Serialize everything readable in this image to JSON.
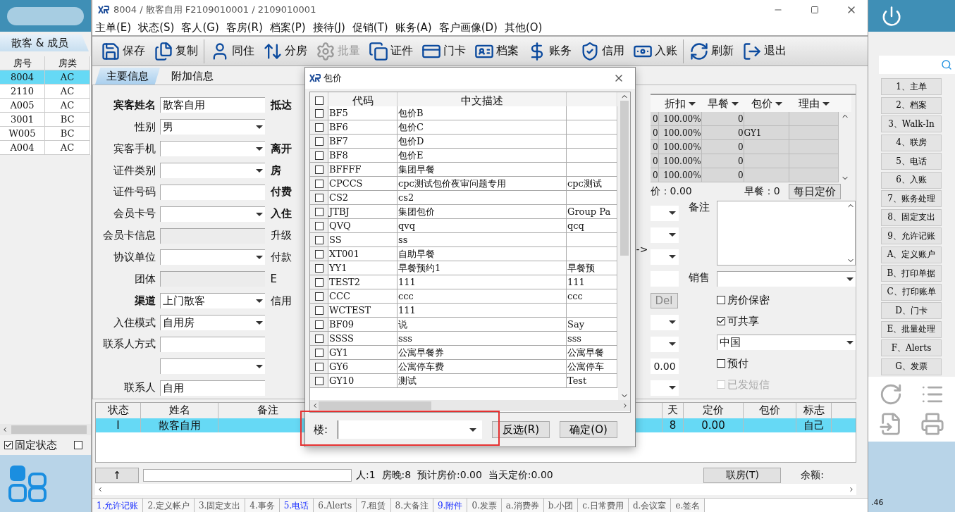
{
  "left_panel": {
    "tab": "散客 & 成员",
    "columns": [
      "房号",
      "房类"
    ],
    "rows": [
      {
        "room": "8004",
        "type": "AC",
        "selected": true
      },
      {
        "room": "2110",
        "type": "AC",
        "selected": false
      },
      {
        "room": "A005",
        "type": "AC",
        "selected": false
      },
      {
        "room": "3001",
        "type": "BC",
        "selected": false
      },
      {
        "room": "W005",
        "type": "BC",
        "selected": false
      },
      {
        "room": "A004",
        "type": "AC",
        "selected": false
      }
    ],
    "fixed_state": {
      "label": "固定状态",
      "checked": true
    },
    "second_checkbox": {
      "checked": false
    }
  },
  "window": {
    "title": "8004 / 散客自用  F2109010001 / 2109010001"
  },
  "menu": [
    "主单(E)",
    "状态(S)",
    "客人(G)",
    "客房(R)",
    "档案(P)",
    "接待(J)",
    "促销(T)",
    "账务(A)",
    "客户画像(D)",
    "其他(O)"
  ],
  "toolbar": [
    {
      "label": "保存",
      "disabled": false
    },
    {
      "label": "复制",
      "disabled": false
    },
    {
      "label": "同住",
      "disabled": false
    },
    {
      "label": "分房",
      "disabled": false
    },
    {
      "label": "批量",
      "disabled": true
    },
    {
      "label": "证件",
      "disabled": false
    },
    {
      "label": "门卡",
      "disabled": false
    },
    {
      "label": "档案",
      "disabled": false
    },
    {
      "label": "账务",
      "disabled": false
    },
    {
      "label": "信用",
      "disabled": false
    },
    {
      "label": "入账",
      "disabled": false
    },
    {
      "label": "刷新",
      "disabled": false
    },
    {
      "label": "退出",
      "disabled": false
    }
  ],
  "tabs": [
    {
      "label": "主要信息",
      "selected": true
    },
    {
      "label": "附加信息",
      "selected": false
    }
  ],
  "form": {
    "rows": [
      {
        "label": "宾客姓名",
        "bold": true,
        "kind": "text",
        "value": "散客自用",
        "side_label": "抵达",
        "side_bold": true
      },
      {
        "label": "性别",
        "bold": false,
        "kind": "select",
        "value": "男"
      },
      {
        "label": "宾客手机",
        "bold": false,
        "kind": "select",
        "side_label": "离开",
        "side_bold": true
      },
      {
        "label": "证件类别",
        "bold": false,
        "kind": "select",
        "side_label": "房",
        "side_bold": true
      },
      {
        "label": "证件号码",
        "bold": false,
        "kind": "text",
        "side_label": "付费",
        "side_bold": true
      },
      {
        "label": "会员卡号",
        "bold": false,
        "kind": "select",
        "side_label": "入住",
        "side_bold": true
      },
      {
        "label": "会员卡信息",
        "bold": false,
        "kind": "readonly",
        "side_label": "升级",
        "side_bold": false
      },
      {
        "label": "协议单位",
        "bold": false,
        "kind": "select",
        "side_label": "付款",
        "side_bold": false
      },
      {
        "label": "团体",
        "bold": false,
        "kind": "readonly",
        "side_label": "E",
        "side_bold": false
      },
      {
        "label": "渠道",
        "bold": true,
        "kind": "select",
        "value": "上门散客",
        "side_label": "信用",
        "side_bold": false
      },
      {
        "label": "入住模式",
        "bold": false,
        "kind": "select",
        "value": "自用房"
      },
      {
        "label": "联系人方式",
        "bold": false,
        "kind": "text"
      },
      {
        "kind": "select"
      },
      {
        "label": "联系人",
        "bold": false,
        "kind": "text",
        "value": "自用"
      }
    ],
    "arrow": "->",
    "rate_grid": {
      "columns": [
        "",
        "折扣",
        "早餐",
        "包价",
        "理由"
      ],
      "rows": [
        {
          "cells": [
            "0",
            "100.00%",
            "0",
            "",
            ""
          ]
        },
        {
          "cells": [
            "0",
            "100.00%",
            "0",
            "GY1",
            ""
          ]
        },
        {
          "cells": [
            "0",
            "100.00%",
            "0",
            "",
            ""
          ]
        },
        {
          "cells": [
            "0",
            "100.00%",
            "0",
            "",
            ""
          ]
        },
        {
          "cells": [
            "0",
            "100.00%",
            "0",
            "",
            ""
          ]
        }
      ]
    },
    "price_text": "价：0.00",
    "breakfast_text": "早餐：0",
    "daily_price_button": "每日定价",
    "partial_fields": [
      {
        "kind": "select"
      },
      {
        "kind": "select"
      },
      {
        "kind": "select"
      },
      {
        "kind": "input"
      },
      {
        "kind": "button",
        "value": "Del"
      },
      {
        "kind": "select"
      },
      {
        "kind": "select"
      },
      {
        "kind": "input",
        "value": "0.00"
      },
      {
        "kind": "select"
      }
    ],
    "remark_label": "备注",
    "sales_label": "销售",
    "options": [
      {
        "kind": "checkbox",
        "label": "房价保密",
        "checked": false,
        "disabled": false
      },
      {
        "kind": "checkbox",
        "label": "可共享",
        "checked": true,
        "disabled": false
      },
      {
        "kind": "select",
        "value": "中国"
      },
      {
        "kind": "checkbox",
        "label": "预付",
        "checked": false,
        "disabled": false
      },
      {
        "kind": "checkbox",
        "label": "已发短信",
        "checked": false,
        "disabled": true
      }
    ]
  },
  "guest_table": {
    "columns": [
      "状态",
      "姓名",
      "备注",
      "天",
      "定价",
      "包价",
      "标志"
    ],
    "rows": [
      {
        "cells": [
          "I",
          "散客自用",
          "",
          "8",
          "0.00",
          "",
          "自己"
        ],
        "selected": true
      }
    ]
  },
  "info_bar": {
    "up_button": "↑",
    "summary": "人:1  房晚:8  预计房价:0.00  当天定价:0.00",
    "link_button": "联房(T)",
    "balance_label": "余额:"
  },
  "bottom_tabs": [
    {
      "label": "1.允许记账",
      "highlighted": true
    },
    {
      "label": "2.定义帐户",
      "highlighted": false
    },
    {
      "label": "3.固定支出",
      "highlighted": false
    },
    {
      "label": "4.事务",
      "highlighted": false
    },
    {
      "label": "5.电话",
      "highlighted": true
    },
    {
      "label": "6.Alerts",
      "highlighted": false
    },
    {
      "label": "7.租赁",
      "highlighted": false
    },
    {
      "label": "8.大备注",
      "highlighted": false
    },
    {
      "label": "9.附件",
      "highlighted": true
    },
    {
      "label": "0.发票",
      "highlighted": false
    },
    {
      "label": "a.消费券",
      "highlighted": false
    },
    {
      "label": "b.小团",
      "highlighted": false
    },
    {
      "label": "c.日常费用",
      "highlighted": false
    },
    {
      "label": "d.会议室",
      "highlighted": false
    },
    {
      "label": "e.签名",
      "highlighted": false
    }
  ],
  "sidebar": {
    "buttons": [
      "1、主单",
      "2、档案",
      "3、Walk-In",
      "4、联房",
      "5、电话",
      "6、入账",
      "7、账务处理",
      "8、固定支出",
      "9、允许记账",
      "A、定义账户",
      "B、打印单据",
      "C、打印账单",
      "D、门卡",
      "E、批量处理",
      "F、Alerts",
      "G、发票"
    ],
    "footer_text": ".46"
  },
  "dialog": {
    "title": "包价",
    "select_all_checked": false,
    "columns": [
      "代码",
      "中文描述"
    ],
    "rows": [
      {
        "code": "BF5",
        "desc": "包价B",
        "column_3": "",
        "checked": false
      },
      {
        "code": "BF6",
        "desc": "包价C",
        "column_3": "",
        "checked": false
      },
      {
        "code": "BF7",
        "desc": "包价D",
        "column_3": "",
        "checked": false
      },
      {
        "code": "BF8",
        "desc": "包价E",
        "column_3": "",
        "checked": false
      },
      {
        "code": "BFFFF",
        "desc": "集团早餐",
        "column_3": "",
        "checked": false
      },
      {
        "code": "CPCCS",
        "desc": "cpc测试包价夜审问题专用",
        "column_3": "cpc测试",
        "checked": false
      },
      {
        "code": "CS2",
        "desc": "cs2",
        "column_3": "",
        "checked": false
      },
      {
        "code": "JTBJ",
        "desc": "集团包价",
        "column_3": "Group Pa",
        "checked": false
      },
      {
        "code": "QVQ",
        "desc": "qvq",
        "column_3": "qcq",
        "checked": false
      },
      {
        "code": "SS",
        "desc": "ss",
        "column_3": "",
        "checked": false
      },
      {
        "code": "XT001",
        "desc": "自助早餐",
        "column_3": "",
        "checked": false
      },
      {
        "code": "YY1",
        "desc": "早餐预约1",
        "column_3": "早餐预",
        "checked": false
      },
      {
        "code": "TEST2",
        "desc": "111",
        "column_3": "111",
        "checked": false
      },
      {
        "code": "CCC",
        "desc": "ccc",
        "column_3": "ccc",
        "checked": false
      },
      {
        "code": "WCTEST",
        "desc": "111",
        "column_3": "",
        "checked": false
      },
      {
        "code": "BF09",
        "desc": "说",
        "column_3": "Say",
        "checked": false
      },
      {
        "code": "SSSS",
        "desc": "sss",
        "column_3": "sss",
        "checked": false
      },
      {
        "code": "GY1",
        "desc": "公寓早餐券",
        "column_3": "公寓早餐",
        "checked": false
      },
      {
        "code": "GY6",
        "desc": "公寓停车费",
        "column_3": "公寓停车",
        "checked": false
      },
      {
        "code": "GY10",
        "desc": "测试",
        "column_3": "Test",
        "checked": false
      }
    ],
    "floor_label": "楼:",
    "buttons": [
      "反选(R)",
      "确定(O)"
    ]
  }
}
